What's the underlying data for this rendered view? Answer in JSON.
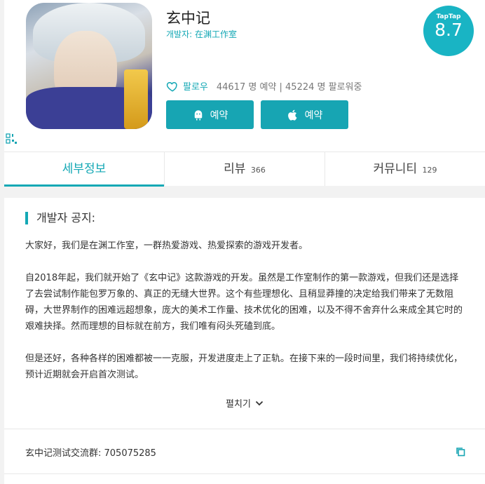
{
  "app": {
    "title": "玄中记",
    "developer": "개발자: 在渊工作室",
    "rating_brand": "TapTap",
    "rating_score": "8.7",
    "follow_label": "팔로우",
    "stats": "44617 명 예약 | 45224 명 팔로워중",
    "buttons": [
      {
        "label": "예약",
        "icon": "android-icon"
      },
      {
        "label": "예약",
        "icon": "apple-icon"
      }
    ]
  },
  "tabs": [
    {
      "label": "세부정보",
      "count": ""
    },
    {
      "label": "리뷰",
      "count": "366"
    },
    {
      "label": "커뮤니티",
      "count": "129"
    }
  ],
  "notice": {
    "heading": "개발자 공지:",
    "paragraphs": [
      "大家好，我们是在渊工作室，一群热爱游戏、热爱探索的游戏开发者。",
      "自2018年起，我们就开始了《玄中记》这款游戏的开发。虽然是工作室制作的第一款游戏，但我们还是选择了去尝试制作能包罗万象的、真正的无缝大世界。这个有些理想化、且稍显莽撞的决定给我们带来了无数阻碍，大世界制作的困难远超想象，庞大的美术工作量、技术优化的困难，以及不得不舍弃什么来成全其它时的艰难抉择。然而理想的目标就在前方，我们唯有闷头死磕到底。",
      "但是还好，各种各样的困难都被一一克服，开发进度走上了正轨。在接下来的一段时间里，我们将持续优化，预计近期就会开启首次测试。"
    ],
    "expand_label": "펼치기",
    "group_text": "玄中记测试交流群:  705075285"
  },
  "colors": {
    "accent": "#17a5b3",
    "badge": "#19b4c4"
  }
}
